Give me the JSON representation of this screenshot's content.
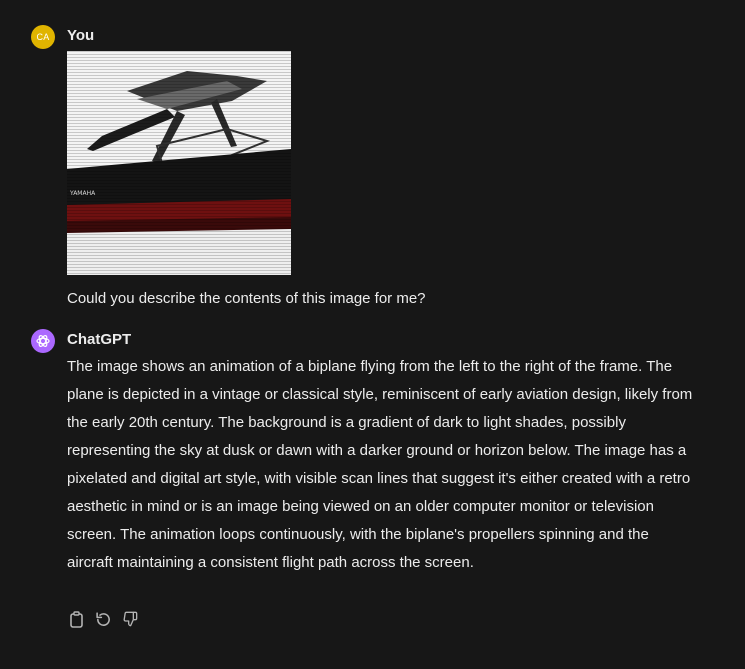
{
  "user_message": {
    "avatar_initials": "CA",
    "author": "You",
    "text": "Could you describe the contents of this image for me?",
    "image": {
      "watermark_text": "YAMAHA"
    }
  },
  "assistant_message": {
    "author": "ChatGPT",
    "text": "The image shows an animation of a biplane flying from the left to the right of the frame. The plane is depicted in a vintage or classical style, reminiscent of early aviation design, likely from the early 20th century. The background is a gradient of dark to light shades, possibly representing the sky at dusk or dawn with a darker ground or horizon below. The image has a pixelated and digital art style, with visible scan lines that suggest it's either created with a retro aesthetic in mind or is an image being viewed on an older computer monitor or television screen. The animation loops continuously, with the biplane's propellers spinning and the aircraft maintaining a consistent flight path across the screen."
  },
  "actions": [
    {
      "icon": "clipboard-icon"
    },
    {
      "icon": "regenerate-icon"
    },
    {
      "icon": "thumbs-down-icon"
    }
  ],
  "colors": {
    "background": "#171717",
    "text": "#ececec",
    "user_avatar": "#e0b400",
    "assistant_avatar": "#ab68ff",
    "icon": "#b4b4b4"
  }
}
